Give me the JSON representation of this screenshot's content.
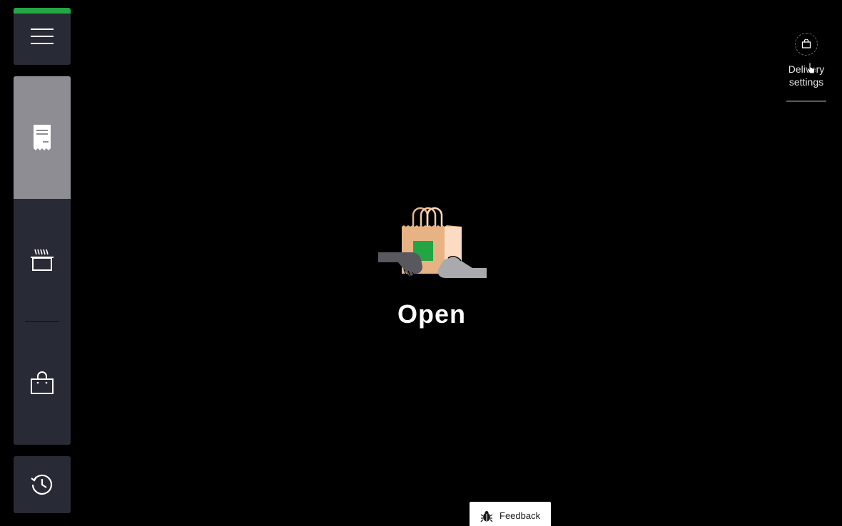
{
  "sidebar": {
    "menu_icon": "hamburger-menu-icon",
    "status_color": "#25a744",
    "items": [
      {
        "icon": "receipt-icon",
        "active": true
      },
      {
        "icon": "cooking-pot-icon",
        "active": false
      },
      {
        "icon": "shopping-bag-icon",
        "active": false
      }
    ],
    "history_icon": "history-clock-icon"
  },
  "delivery_settings": {
    "icon": "bag-icon",
    "label": "Delivery settings"
  },
  "main": {
    "illustration": "hands-with-bag-illustration",
    "status": "Open"
  },
  "feedback": {
    "icon": "bug-icon",
    "label": "Feedback"
  },
  "colors": {
    "background": "#000000",
    "sidebar": "#282a36",
    "active_item": "#8e8d93",
    "status_green": "#25a744",
    "bag_tan": "#e8b384",
    "bag_light": "#fbdcc3",
    "bag_green": "#24a544"
  }
}
